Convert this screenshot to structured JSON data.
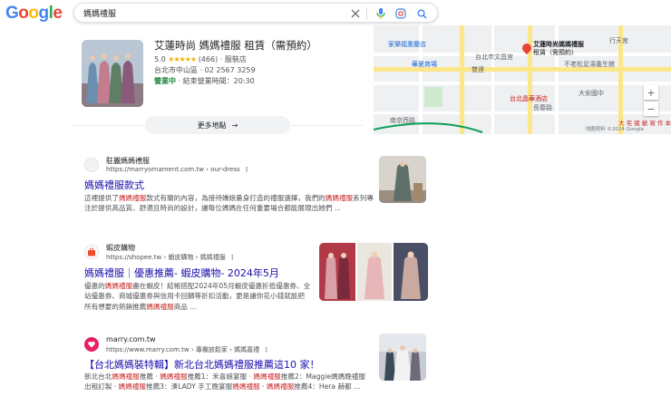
{
  "search": {
    "logo": "Google",
    "query": "媽媽禮服"
  },
  "business": {
    "name": "艾蓮時尚 媽媽禮服 租賃（需預約）",
    "rating": "5.0",
    "stars": "★★★★★",
    "reviews": "(466)",
    "category": "· 服裝店",
    "address": "台北市中山區 · 02 2567 3259",
    "open_status": "營業中",
    "hours": " · 結束營業時間：20:30",
    "more_places": "更多地點",
    "more_arrow": "→"
  },
  "map": {
    "labels": {
      "shop": "艾蓮時尚媽媽禮服",
      "shop2": "租賃（需預約）",
      "carrefour": "家樂福重慶店",
      "huaxi": "華夏商場",
      "wenchang": "台北市文昌宮",
      "xingtian": "行天宮",
      "xinyi": "不老松足湯養生館",
      "shuangtian": "雙連",
      "taipei_hotel": "台北晶華酒店",
      "changan": "長春路",
      "nanjing": "南京西路",
      "dalong": "大安國中",
      "corner": "大 宅 猪 爺 寫 作 本",
      "credit": "地圖資料 ©2024 Google"
    },
    "zoom_in": "+",
    "zoom_out": "−"
  },
  "results": [
    {
      "site_name": "駐麗媽媽禮服",
      "url": "https://marryornament.com.tw › our-dress",
      "title": "媽媽禮服款式",
      "snippet": [
        {
          "t": "這裡提供了",
          "h": false
        },
        {
          "t": "媽媽禮服",
          "h": true
        },
        {
          "t": "款式有關的內容，為接待嬌娘量身打造的禮服選擇，我們的",
          "h": false
        },
        {
          "t": "媽媽禮服",
          "h": true
        },
        {
          "t": "系列專注於提供高品質、舒適且時尚的設計，讓每位媽媽在任何重要場合都能展現出她們 ...",
          "h": false
        }
      ]
    },
    {
      "site_name": "蝦皮購物",
      "url": "https://shopee.tw › 蝦皮購物 › 媽媽禮服",
      "title": "媽媽禮服｜優惠推薦- 蝦皮購物- 2024年5月",
      "snippet": [
        {
          "t": "優惠的",
          "h": false
        },
        {
          "t": "媽媽禮服",
          "h": true
        },
        {
          "t": "盡在蝦皮！結帳搭配2024年05月蝦皮優惠折抵優惠券、全站優惠券、商城優惠券與信用卡回饋等折扣活動，更是讓你花小錢就能把所有想要的熱銷推薦",
          "h": false
        },
        {
          "t": "媽媽禮服",
          "h": true
        },
        {
          "t": "商品 ...",
          "h": false
        }
      ]
    },
    {
      "site_name": "marry.com.tw",
      "url": "https://www.marry.com.tw › 專欄放鬆家 › 媽媽嘉禮",
      "title": "【台北媽媽裝特輯】新北台北媽媽禮服推薦這10 家！",
      "snippet": [
        {
          "t": "新北台北",
          "h": false
        },
        {
          "t": "媽媽禮服",
          "h": true
        },
        {
          "t": "推薦 · ",
          "h": false
        },
        {
          "t": "媽媽禮服",
          "h": true
        },
        {
          "t": "推薦1：禾喜娘宴服 · ",
          "h": false
        },
        {
          "t": "媽媽禮服",
          "h": true
        },
        {
          "t": "推薦2：Maggie媽媽晚禮服出租訂製 · ",
          "h": false
        },
        {
          "t": "媽媽禮服",
          "h": true
        },
        {
          "t": "推薦3：湊LADY 手工晚宴服",
          "h": false
        },
        {
          "t": "媽媽禮服",
          "h": true
        },
        {
          "t": " · ",
          "h": false
        },
        {
          "t": "媽媽禮服",
          "h": true
        },
        {
          "t": "推薦4：Hera 赫都 ...",
          "h": false
        }
      ]
    }
  ],
  "colors": {
    "link": "#1a0dab",
    "highlight": "#c5221f",
    "open": "#188038",
    "star": "#f5b400"
  }
}
